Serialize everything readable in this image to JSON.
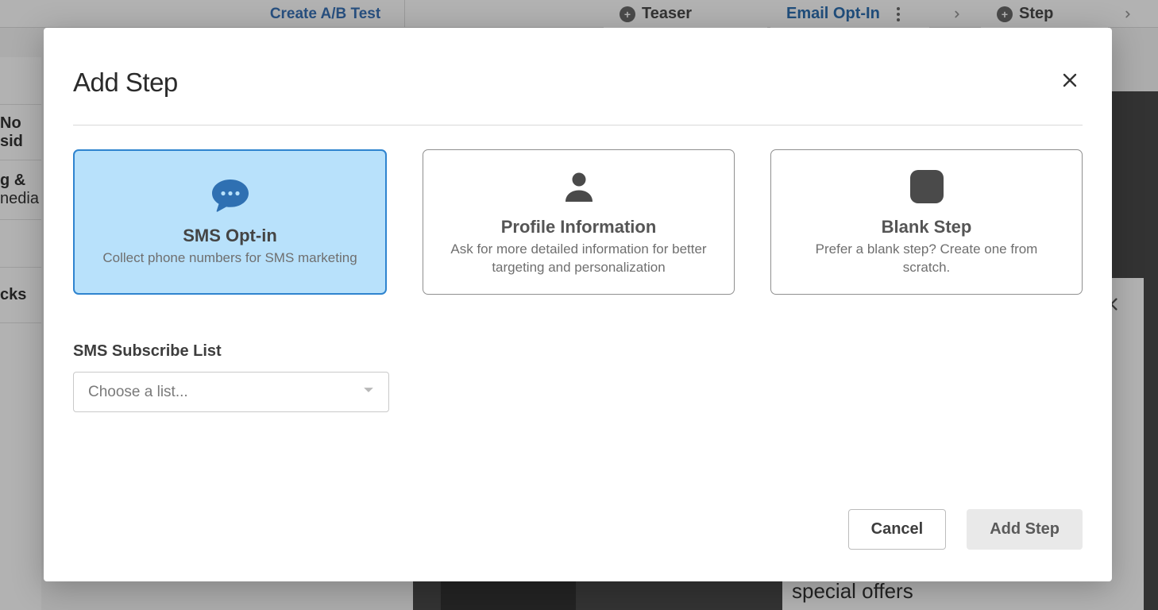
{
  "background": {
    "ab_test_link": "Create A/B Test",
    "steps": {
      "teaser": "Teaser",
      "email_optin": "Email Opt-In",
      "step": "Step"
    },
    "sidebar": {
      "no_sidebar": "No sid",
      "line2a": "g &",
      "line2b": "nedia",
      "line3": "cks"
    },
    "preview_text": "special offers"
  },
  "modal": {
    "title": "Add Step",
    "options": [
      {
        "key": "sms-opt-in",
        "title": "SMS Opt-in",
        "desc": "Collect phone numbers for SMS marketing",
        "selected": true,
        "icon": "speech-bubble-icon"
      },
      {
        "key": "profile-info",
        "title": "Profile Information",
        "desc": "Ask for more detailed information for better targeting and personalization",
        "selected": false,
        "icon": "person-icon"
      },
      {
        "key": "blank-step",
        "title": "Blank Step",
        "desc": "Prefer a blank step? Create one from scratch.",
        "selected": false,
        "icon": "square-icon"
      }
    ],
    "field": {
      "label": "SMS Subscribe List",
      "placeholder": "Choose a list..."
    },
    "actions": {
      "cancel": "Cancel",
      "confirm": "Add Step"
    }
  }
}
